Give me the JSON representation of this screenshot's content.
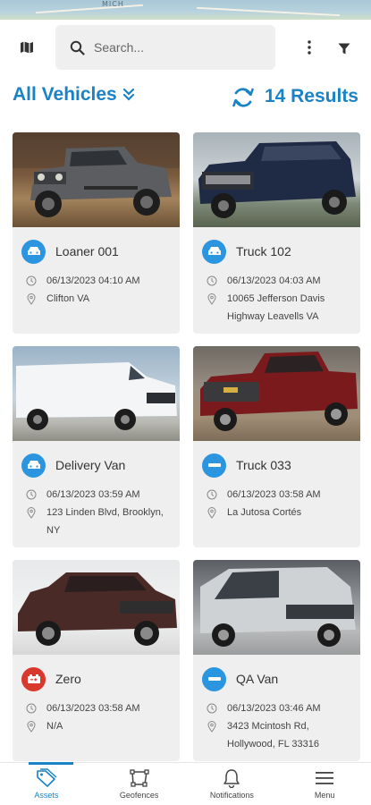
{
  "map_strip": {
    "label": "MICH"
  },
  "search": {
    "placeholder": "Search..."
  },
  "header": {
    "selector_label": "All Vehicles",
    "results_label": "14 Results"
  },
  "colors": {
    "accent": "#1a83c6",
    "badge_blue": "#2c95e0",
    "badge_red": "#d9382c",
    "card_bg": "#efefef"
  },
  "vehicles": [
    {
      "name": "Loaner 001",
      "datetime": "06/13/2023 04:10 AM",
      "location": "Clifton VA",
      "status": "blue",
      "icon": "car-front-icon"
    },
    {
      "name": "Truck 102",
      "datetime": "06/13/2023 04:03 AM",
      "location": "10065 Jefferson Davis Highway Leavells VA",
      "status": "blue",
      "icon": "car-front-icon"
    },
    {
      "name": "Delivery Van",
      "datetime": "06/13/2023 03:59 AM",
      "location": "123 Linden Blvd, Brooklyn, NY",
      "status": "blue",
      "icon": "car-front-icon"
    },
    {
      "name": "Truck 033",
      "datetime": "06/13/2023 03:58 AM",
      "location": "La Jutosa Cortés",
      "status": "blue",
      "icon": "minus-icon"
    },
    {
      "name": "Zero",
      "datetime": "06/13/2023 03:58 AM",
      "location": "N/A",
      "status": "red",
      "icon": "battery-icon"
    },
    {
      "name": "QA Van",
      "datetime": "06/13/2023 03:46 AM",
      "location": "3423 Mcintosh Rd, Hollywood, FL 33316",
      "status": "blue",
      "icon": "minus-icon"
    }
  ],
  "nav": [
    {
      "label": "Assets",
      "icon": "tag-icon",
      "active": true
    },
    {
      "label": "Geofences",
      "icon": "geofence-icon",
      "active": false
    },
    {
      "label": "Notifications",
      "icon": "bell-icon",
      "active": false
    },
    {
      "label": "Menu",
      "icon": "hamburger-icon",
      "active": false
    }
  ]
}
